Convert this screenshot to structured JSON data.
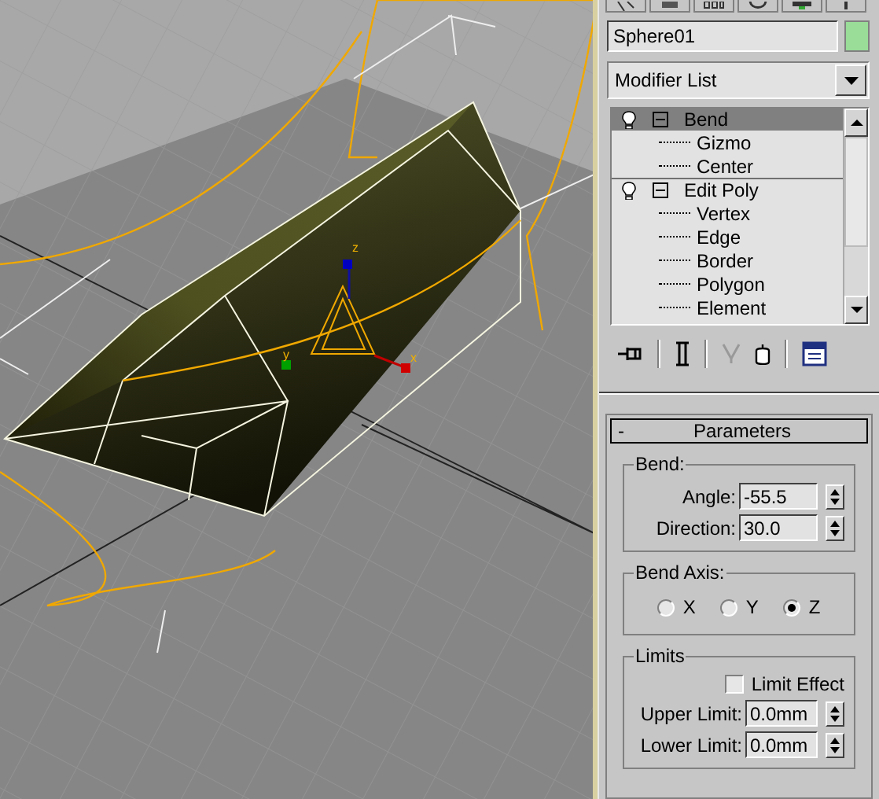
{
  "viewport": {
    "axis_labels": [
      {
        "kind": "z",
        "text": "z"
      },
      {
        "kind": "y",
        "text": "y"
      },
      {
        "kind": "x",
        "text": "x"
      }
    ]
  },
  "command_panel": {
    "object": {
      "name": "Sphere01",
      "color": "#99dd99"
    },
    "modifier_list": "Modifier List",
    "stack": [
      {
        "name": "Bend",
        "selected": true,
        "expanded": true,
        "children": [
          {
            "name": "Gizmo"
          },
          {
            "name": "Center"
          }
        ]
      },
      {
        "name": "Edit Poly",
        "selected": false,
        "expanded": true,
        "children": [
          {
            "name": "Vertex"
          },
          {
            "name": "Edge"
          },
          {
            "name": "Border"
          },
          {
            "name": "Polygon"
          },
          {
            "name": "Element"
          }
        ]
      }
    ],
    "rollout": {
      "toggle": "-",
      "title": "Parameters",
      "groups": [
        {
          "kind": "spinners",
          "title": "Bend:",
          "fields": [
            {
              "label": "Angle:",
              "value": "-55.5"
            },
            {
              "label": "Direction:",
              "value": "30.0"
            }
          ]
        },
        {
          "kind": "radios",
          "title": "Bend Axis:",
          "options": [
            {
              "label": "X",
              "selected": false
            },
            {
              "label": "Y",
              "selected": false
            },
            {
              "label": "Z",
              "selected": true
            }
          ]
        },
        {
          "kind": "limits",
          "title": "Limits",
          "checkbox": {
            "label": "Limit Effect",
            "checked": false
          },
          "fields": [
            {
              "label": "Upper Limit:",
              "value": "0.0mm"
            },
            {
              "label": "Lower Limit:",
              "value": "0.0mm"
            }
          ]
        }
      ]
    }
  }
}
